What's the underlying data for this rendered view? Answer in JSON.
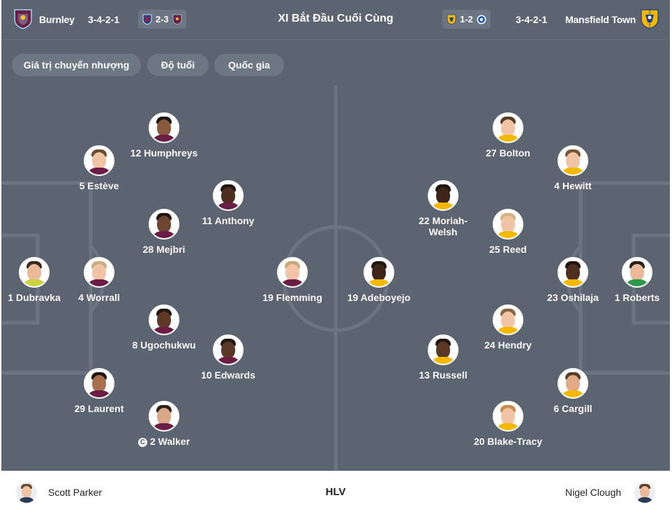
{
  "header": {
    "title": "XI Bắt Đầu Cuối Cùng",
    "home": {
      "name": "Burnley",
      "formation": "3-4-2-1",
      "crest_color": "#6c1d45",
      "crest_accent": "#99d6ea",
      "crest_icon": "burnley-crest-icon"
    },
    "away": {
      "name": "Mansfield Town",
      "formation": "3-4-2-1",
      "crest_color": "#f5b800",
      "crest_accent": "#1d3c8c",
      "crest_icon": "mansfield-crest-icon"
    },
    "home_last_match": {
      "score": "2-3",
      "opponent_icon": "crystal-palace-crest-icon",
      "team_icon": "burnley-crest-icon"
    },
    "away_last_match": {
      "score": "1-2",
      "team_icon": "mansfield-crest-icon",
      "opponent_icon": "peterborough-crest-icon"
    }
  },
  "filters": [
    "Giá trị chuyển nhượng",
    "Độ tuổi",
    "Quốc gia"
  ],
  "home_players": [
    {
      "label": "1 Dubravka"
    },
    {
      "label": "4 Worrall"
    },
    {
      "label": "5 Estève"
    },
    {
      "label": "29 Laurent"
    },
    {
      "label": "12 Humphreys"
    },
    {
      "label": "28 Mejbri"
    },
    {
      "label": "8 Ugochukwu"
    },
    {
      "label": "2 Walker",
      "captain": "C"
    },
    {
      "label": "11 Anthony"
    },
    {
      "label": "10 Edwards"
    },
    {
      "label": "19 Flemming"
    }
  ],
  "away_players": [
    {
      "label": "1 Roberts"
    },
    {
      "label": "23 Oshilaja"
    },
    {
      "label": "4 Hewitt"
    },
    {
      "label": "6 Cargill"
    },
    {
      "label": "27 Bolton"
    },
    {
      "label": "25 Reed"
    },
    {
      "label": "24 Hendry"
    },
    {
      "label": "20 Blake-Tracy"
    },
    {
      "label": "22 Moriah-Welsh"
    },
    {
      "label": "13 Russell"
    },
    {
      "label": "19 Adeboyejo"
    }
  ],
  "footer": {
    "home_coach": "Scott Parker",
    "center_label": "HLV",
    "away_coach": "Nigel Clough"
  },
  "colors": {
    "pitch": "#5b6470",
    "pitch_lines": "#6b7480",
    "chip": "#6d7783"
  }
}
